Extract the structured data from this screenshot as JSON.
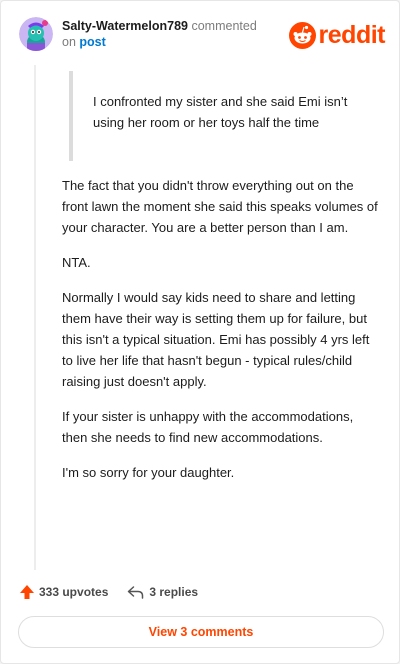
{
  "comment": {
    "username": "Salty-Watermelon789",
    "action": "commented",
    "on": "on",
    "target": "post"
  },
  "brand": {
    "name": "reddit",
    "color": "#ff4500"
  },
  "quote": "I confronted my sister and she said Emi isn’t using her room or her toys half the time",
  "paragraphs": [
    "The fact that you didn't throw everything out on the front lawn the moment she said this speaks volumes of your character. You are a better person than I am.",
    "NTA.",
    "Normally I would say kids need to share and letting them have their way is setting them up for failure, but this isn't a typical situation. Emi has possibly 4 yrs left to live her life that hasn't begun - typical rules/child raising just doesn't apply.",
    "If your sister is unhappy with the accommodations, then she needs to find new accommodations.",
    "I'm so sorry for your daughter."
  ],
  "stats": {
    "upvotes": "333 upvotes",
    "replies": "3 replies"
  },
  "footer": {
    "view_comments": "View 3 comments"
  },
  "icons": {
    "avatar": "snoo-avatar-icon",
    "upvote": "upvote-arrow-icon",
    "reply": "reply-arrow-icon",
    "logo": "reddit-snoo-icon"
  }
}
